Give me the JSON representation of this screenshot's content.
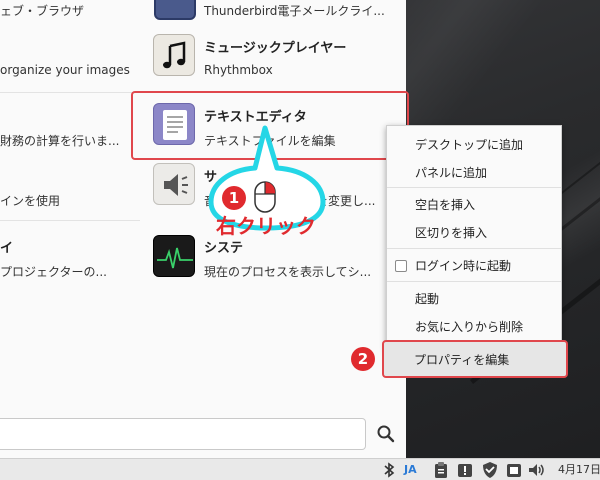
{
  "menu": {
    "left": {
      "browser_desc": "ェブ・ブラウザ",
      "images_desc": "organize your images",
      "finance_desc": "財務の計算を行いま...",
      "input_desc": "インを使用",
      "display_title": "イ",
      "projector_desc": "プロジェクターの..."
    },
    "apps": [
      {
        "title": "",
        "subtitle": "Thunderbird電子メールクライ...",
        "icon": "mail-icon"
      },
      {
        "title": "ミュージックプレイヤー",
        "subtitle": "Rhythmbox",
        "icon": "music-note-icon"
      },
      {
        "title": "テキストエディタ",
        "subtitle": "テキストファイルを編集",
        "icon": "text-editor-icon"
      },
      {
        "title": "サ",
        "subtitle": "音",
        "subtitle_tail": "を変更し...",
        "icon": "speaker-icon"
      },
      {
        "title": "システ",
        "subtitle": "現在のプロセスを表示してシ...",
        "icon": "system-monitor-icon"
      }
    ],
    "search_value": "",
    "search_icon": "search-icon"
  },
  "annotation": {
    "step1": "1",
    "step1_label": "右クリック",
    "step2": "2"
  },
  "context_menu": {
    "items": [
      {
        "label": "デスクトップに追加"
      },
      {
        "label": "パネルに追加"
      },
      {
        "label": "空白を挿入"
      },
      {
        "label": "区切りを挿入"
      },
      {
        "label": "ログイン時に起動",
        "checkbox": true,
        "checked": false
      },
      {
        "label": "起動"
      },
      {
        "label": "お気に入りから削除"
      },
      {
        "label": "プロパティを編集"
      }
    ]
  },
  "taskbar": {
    "ime": "JA",
    "date": "4月17日",
    "icons": [
      "bluetooth-icon",
      "clipboard-icon",
      "update-notice-icon",
      "shield-icon",
      "window-icon",
      "volume-icon"
    ]
  },
  "colors": {
    "accent_red": "#e02a2e",
    "callout_cyan": "#24d6e6",
    "ime_blue": "#2a7ad6"
  }
}
